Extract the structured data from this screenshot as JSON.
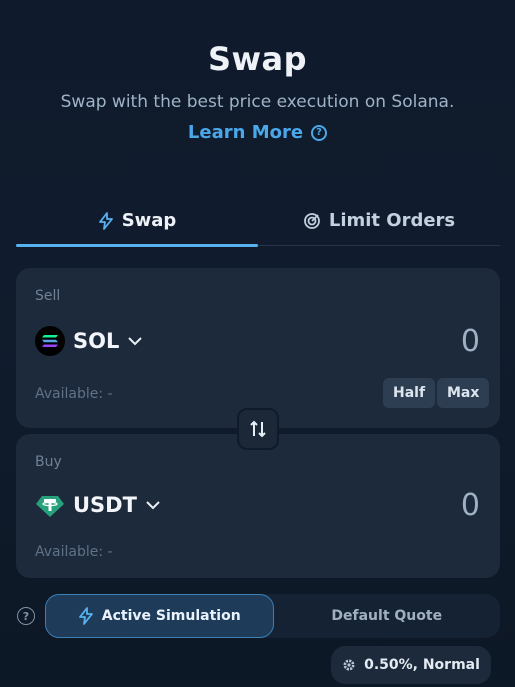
{
  "header": {
    "title": "Swap",
    "subtitle": "Swap with the best price execution on Solana.",
    "learn_more": "Learn More",
    "learn_more_icon": "question-circle-icon"
  },
  "tabs": [
    {
      "label": "Swap",
      "icon": "lightning-icon",
      "active": true
    },
    {
      "label": "Limit Orders",
      "icon": "target-icon",
      "active": false
    }
  ],
  "sell": {
    "label": "Sell",
    "token": "SOL",
    "amount": "0",
    "available": "Available: -",
    "half_label": "Half",
    "max_label": "Max"
  },
  "buy": {
    "label": "Buy",
    "token": "USDT",
    "amount": "0",
    "available": "Available: -"
  },
  "switch_icon": "swap-arrows-icon",
  "mode": {
    "help_icon": "question-circle-icon",
    "options": [
      {
        "label": "Active Simulation",
        "icon": "lightning-icon",
        "active": true
      },
      {
        "label": "Default Quote",
        "active": false
      }
    ]
  },
  "slippage": {
    "label": "0.50%, Normal",
    "icon": "gear-icon"
  },
  "colors": {
    "accent": "#4aa8ea",
    "background": "#0f1b2c",
    "card": "#1d2a3b"
  }
}
